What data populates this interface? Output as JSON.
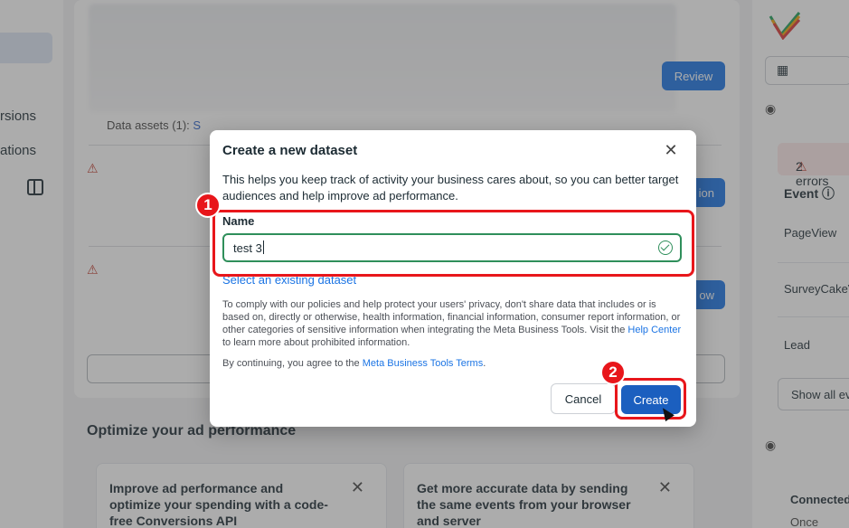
{
  "nav": {
    "items": [
      "rsions",
      "ations"
    ]
  },
  "main": {
    "data_assets_prefix": "Data assets (1):",
    "data_assets_link": "S",
    "review_label": "Review",
    "side_btn_1": "ion",
    "side_btn_2": "ow",
    "optimize_title": "Optimize your ad performance",
    "tip_cards": [
      {
        "text": "Improve ad performance and optimize your spending with a code-free Conversions API"
      },
      {
        "text": "Get more accurate data by sending the same events from your browser and server"
      }
    ]
  },
  "right": {
    "errors": "2 errors",
    "event_header": "Event",
    "events": [
      "PageView",
      "SurveyCakeV",
      "Lead"
    ],
    "show_all": "Show all ev",
    "connected": "Connected",
    "once": "Once custo"
  },
  "modal": {
    "title": "Create a new dataset",
    "description": "This helps you keep track of activity your business cares about, so you can better target audiences and help improve ad performance.",
    "name_label": "Name",
    "name_value": "test 3",
    "select_existing": "Select an existing dataset",
    "privacy_text": "To comply with our policies and help protect your users' privacy, don't share data that includes or is based on, directly or otherwise, health information, financial information, consumer report information, or other categories of sensitive information when integrating the Meta Business Tools. Visit the",
    "help_center": "Help Center",
    "privacy_suffix": "to learn more about prohibited information.",
    "terms_prefix": "By continuing, you agree to the",
    "terms_link": "Meta Business Tools Terms",
    "terms_suffix": ".",
    "cancel_label": "Cancel",
    "create_label": "Create"
  },
  "annotations": {
    "step1": "1",
    "step2": "2",
    "color": "#e8161b"
  }
}
